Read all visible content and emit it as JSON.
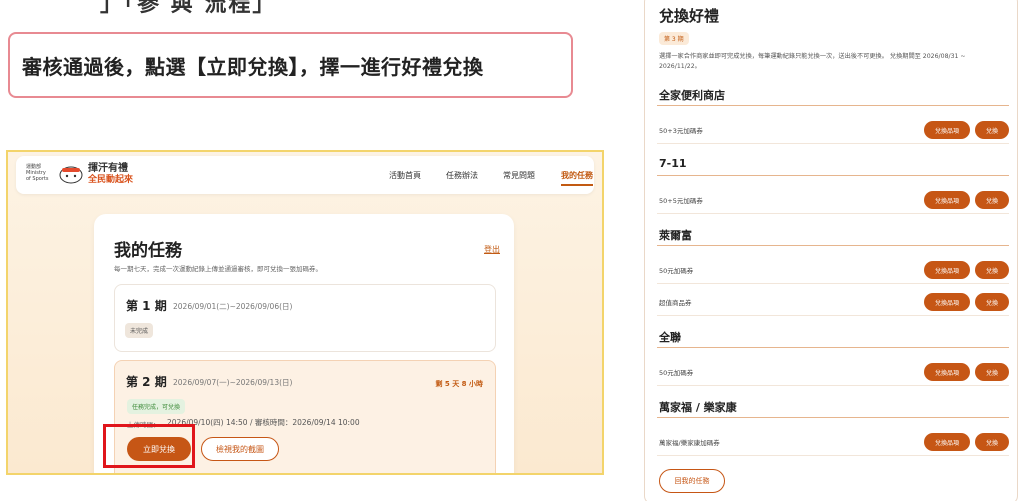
{
  "cut_heading": "」「參 與 流程」",
  "instruction": "審核通過後，點選【立即兌換】，擇一進行好禮兌換",
  "app": {
    "logo_ministry": "運動部 Ministry of Sports",
    "logo_main": "揮汗有禮",
    "logo_sub": "全民動起來",
    "nav": [
      "活動首頁",
      "任務辦法",
      "常見問題",
      "我的任務"
    ]
  },
  "my_tasks": {
    "title": "我的任務",
    "logout": "登出",
    "description": "每一期七天，完成一次運動紀錄上傳並通過審核，即可兌換一張加碼券。",
    "period1": {
      "name": "第 1 期",
      "dates": "2026/09/01(二)~2026/09/06(日)",
      "status": "未完成"
    },
    "period2": {
      "name": "第 2 期",
      "dates": "2026/09/07(一)~2026/09/13(日)",
      "remaining": "剩 5 天 8 小時",
      "status": "任務完成，可兌換",
      "upload_label": "上傳時間：",
      "upload_value": "2026/09/10(四) 14:50 / 審核時間：2026/09/14 10:00",
      "redeem_button": "立即兌換",
      "view_button": "檢視我的截圖"
    }
  },
  "redeem_panel": {
    "title": "兌換好禮",
    "week_badge": "第 3 期",
    "description": "選擇一家合作商家並即可完成兌換，每筆運動紀錄只能兌換一次，送出後不可更換。 兌換期間至 2026/08/31 ~ 2026/11/22。",
    "stores": [
      {
        "name": "全家便利商店",
        "items": [
          "50+3元加碼券"
        ]
      },
      {
        "name": "7-11",
        "items": [
          "50+5元加碼券"
        ]
      },
      {
        "name": "萊爾富",
        "items": [
          "50元加碼券",
          "超值商品券"
        ]
      },
      {
        "name": "全聯",
        "items": [
          "50元加碼券"
        ]
      },
      {
        "name": "萬家福 / 樂家康",
        "items": [
          "萬家福/樂家康加碼券"
        ]
      }
    ],
    "items_button": "兌換品項",
    "exchange_button": "兌換",
    "back_button": "回我的任務"
  },
  "colors": {
    "accent": "#c65615",
    "highlight_box": "#e0151b",
    "callout_border": "#e88a92",
    "frame_border": "#f3d46b"
  }
}
